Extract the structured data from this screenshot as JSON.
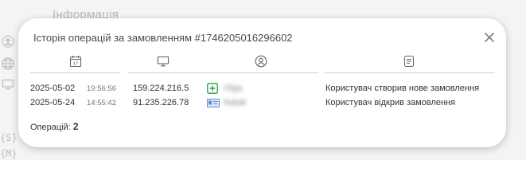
{
  "background": {
    "title": "Інформація",
    "side_letters": [
      "{S}",
      "{M}"
    ]
  },
  "modal": {
    "title": "Історія операцій за замовленням #1746205016296602",
    "columns": [
      {
        "icon": "calendar-icon"
      },
      {
        "icon": "monitor-icon"
      },
      {
        "icon": "user-icon"
      },
      {
        "icon": "document-icon"
      }
    ],
    "rows": [
      {
        "date": "2025-05-02",
        "time": "19:56:56",
        "ip": "159.224.216.5",
        "user_icon": "add-user-badge-icon",
        "user": "Olga",
        "action": "Користувач створив нове замовлення"
      },
      {
        "date": "2025-05-24",
        "time": "14:55:42",
        "ip": "91.235.226.78",
        "user_icon": "id-card-icon",
        "user": "Natali",
        "action": "Користувач відкрив замовлення"
      }
    ],
    "count_label": "Операцій: ",
    "count_value": "2"
  },
  "colors": {
    "accent_green": "#2e9d45",
    "card_blue": "#5b8fd6"
  }
}
